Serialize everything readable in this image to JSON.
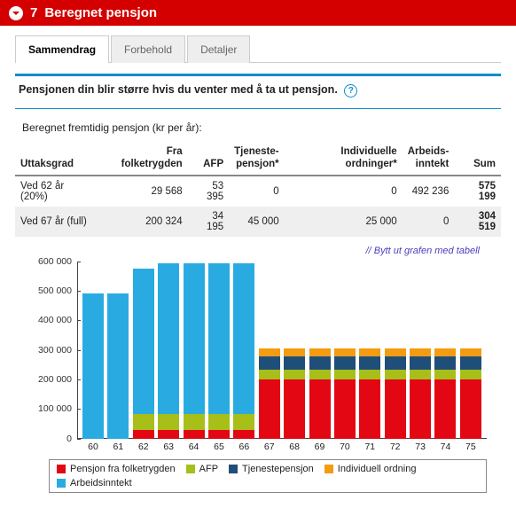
{
  "header": {
    "step": "7",
    "title": "Beregnet pensjon"
  },
  "tabs": [
    "Sammendrag",
    "Forbehold",
    "Detaljer"
  ],
  "lead": "Pensjonen din blir større hvis du venter med å ta ut pensjon.",
  "subhead": "Beregnet fremtidig pensjon (kr per år):",
  "table": {
    "columns": [
      "Uttaksgrad",
      "Fra folketrygden",
      "AFP",
      "Tjeneste-\npensjon*",
      "Individuelle ordninger*",
      "Arbeids-\ninntekt",
      "Sum"
    ],
    "rows": [
      {
        "label": "Ved 62 år (20%)",
        "cells": [
          "29 568",
          "53 395",
          "0",
          "0",
          "492 236",
          "575 199"
        ]
      },
      {
        "label": "Ved 67 år (full)",
        "cells": [
          "200 324",
          "34 195",
          "45 000",
          "25 000",
          "0",
          "304 519"
        ]
      }
    ]
  },
  "swap_link": "// Bytt ut grafen med tabell",
  "legend": {
    "folke": "Pensjon fra folketrygden",
    "afp": "AFP",
    "tjen": "Tjenestepensjon",
    "indiv": "Individuell ordning",
    "arbeid": "Arbeidsinntekt"
  },
  "colors": {
    "folke": "#e30613",
    "afp": "#a8bf19",
    "tjen": "#1f4e79",
    "indiv": "#f39c12",
    "arbeid": "#29abe2"
  },
  "chart_data": {
    "type": "bar",
    "stacked": true,
    "ylim": [
      0,
      600000
    ],
    "yticks": [
      0,
      100000,
      200000,
      300000,
      400000,
      500000,
      600000
    ],
    "ytick_labels": [
      "0",
      "100 000",
      "200 000",
      "300 000",
      "400 000",
      "500 000",
      "600 000"
    ],
    "categories": [
      60,
      61,
      62,
      63,
      64,
      65,
      66,
      67,
      68,
      69,
      70,
      71,
      72,
      73,
      74,
      75
    ],
    "series": [
      {
        "name": "Pensjon fra folketrygden",
        "key": "folke",
        "values": [
          0,
          0,
          30000,
          30000,
          30000,
          30000,
          30000,
          200000,
          200000,
          200000,
          200000,
          200000,
          200000,
          200000,
          200000,
          200000
        ]
      },
      {
        "name": "AFP",
        "key": "afp",
        "values": [
          0,
          0,
          53000,
          53000,
          53000,
          53000,
          53000,
          34000,
          34000,
          34000,
          34000,
          34000,
          34000,
          34000,
          34000,
          34000
        ]
      },
      {
        "name": "Tjenestepensjon",
        "key": "tjen",
        "values": [
          0,
          0,
          0,
          0,
          0,
          0,
          0,
          45000,
          45000,
          45000,
          45000,
          45000,
          45000,
          45000,
          45000,
          45000
        ]
      },
      {
        "name": "Individuell ordning",
        "key": "indiv",
        "values": [
          0,
          0,
          0,
          0,
          0,
          0,
          0,
          25000,
          25000,
          25000,
          25000,
          25000,
          25000,
          25000,
          25000,
          25000
        ]
      },
      {
        "name": "Arbeidsinntekt",
        "key": "arbeid",
        "values": [
          492000,
          492000,
          492000,
          510000,
          510000,
          510000,
          510000,
          0,
          0,
          0,
          0,
          0,
          0,
          0,
          0,
          0
        ]
      }
    ]
  }
}
